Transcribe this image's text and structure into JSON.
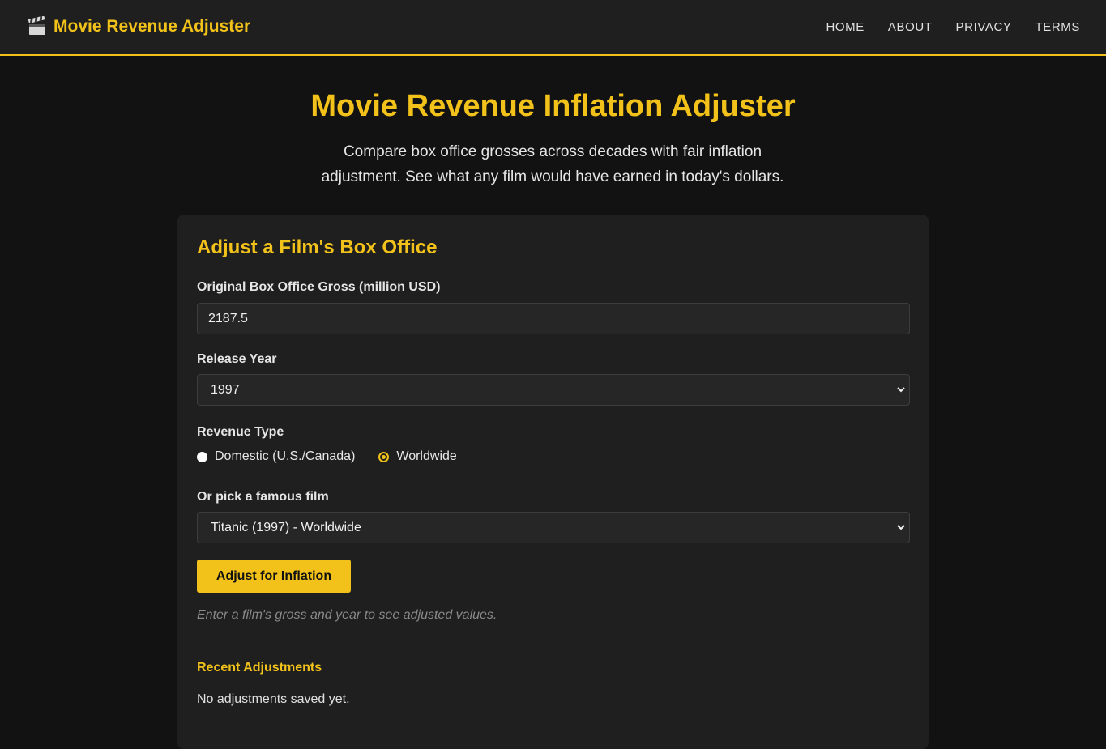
{
  "header": {
    "brand": "Movie Revenue Adjuster",
    "brand_icon": "clapperboard-icon",
    "nav": [
      "HOME",
      "ABOUT",
      "PRIVACY",
      "TERMS"
    ]
  },
  "hero": {
    "title": "Movie Revenue Inflation Adjuster",
    "subtitle": "Compare box office grosses across decades with fair inflation adjustment. See what any film would have earned in today's dollars."
  },
  "form": {
    "title": "Adjust a Film's Box Office",
    "gross_label": "Original Box Office Gross (million USD)",
    "gross_value": "2187.5",
    "year_label": "Release Year",
    "year_value": "1997",
    "revenue_label": "Revenue Type",
    "revenue_options": [
      "Domestic (U.S./Canada)",
      "Worldwide"
    ],
    "revenue_selected": "Worldwide",
    "film_label": "Or pick a famous film",
    "film_value": "Titanic (1997) - Worldwide",
    "submit_label": "Adjust for Inflation",
    "hint": "Enter a film's gross and year to see adjusted values."
  },
  "recent": {
    "title": "Recent Adjustments",
    "empty": "No adjustments saved yet."
  },
  "colors": {
    "accent": "#f2c21a",
    "background": "#121212",
    "panel": "#1f1f1f"
  }
}
